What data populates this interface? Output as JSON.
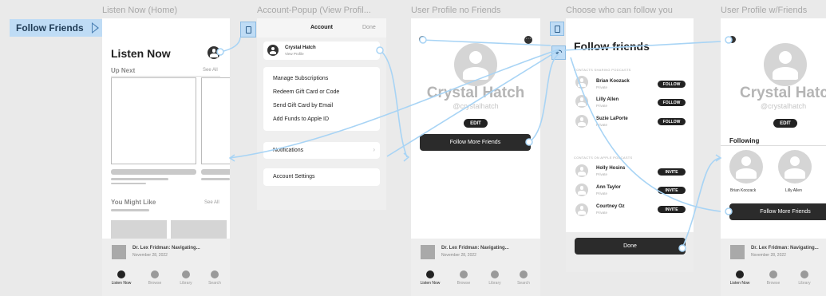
{
  "flow_label": "Follow Friends",
  "frames": {
    "listen_now": {
      "title": "Listen Now (Home)",
      "header": "Listen Now",
      "up_next": "Up Next",
      "see_all": "See All",
      "you_might_like": "You Might Like",
      "see_all_2": "See All",
      "now_playing_title": "Dr. Lex Fridman: Navigating...",
      "now_playing_date": "November 28, 2022",
      "tabs": [
        "Listen Now",
        "Browse",
        "Library",
        "Search"
      ]
    },
    "account_popup": {
      "title": "Account-Popup (View Profil...",
      "header": "Account",
      "done": "Done",
      "user_name": "Crystal Hatch",
      "view_profile": "View Profile",
      "menu": [
        "Manage Subscriptions",
        "Redeem Gift Card or Code",
        "Send Gift Card by Email",
        "Add Funds to Apple ID"
      ],
      "notifications": "Notifications",
      "account_settings": "Account Settings"
    },
    "profile_no_friends": {
      "title": "User Profile no Friends",
      "name": "Crystal Hatch",
      "handle": "@crystalhatch",
      "edit": "EDIT",
      "follow_more": "Follow More Friends",
      "now_playing_title": "Dr. Lex Fridman: Navigating...",
      "now_playing_date": "November 28, 2022",
      "tabs": [
        "Listen Now",
        "Browse",
        "Library",
        "Search"
      ]
    },
    "choose_followers": {
      "title": "Choose who can follow you",
      "header": "Follow friends",
      "section1": "CONTACTS SHARING PODCASTS",
      "section2": "CONTACTS ON APPLE PODCASTS",
      "follow_label": "FOLLOW",
      "invite_label": "INVITE",
      "private": "Private",
      "sharing": [
        "Brian Koozack",
        "Lilly Allen",
        "Suzie LaPorte"
      ],
      "on_apple": [
        "Holly Hosins",
        "Ann Taylor",
        "Courtney Oz"
      ],
      "done": "Done"
    },
    "profile_with_friends": {
      "title": "User Profile w/Friends",
      "name": "Crystal Hatch",
      "handle": "@crystalhatch",
      "edit": "EDIT",
      "following": "Following",
      "friends": [
        "Brian Koozack",
        "Lilly Allen"
      ],
      "follow_more": "Follow More Friends",
      "now_playing_title": "Dr. Lex Fridman: Navigating...",
      "now_playing_date": "November 28, 2022",
      "tabs": [
        "Listen Now",
        "Browse",
        "Library"
      ]
    }
  },
  "colors": {
    "canvas": "#eaeaea",
    "link": "#a8d4f5",
    "flow_label_bg": "#bfdcf5",
    "button_dark": "#2b2b2b"
  }
}
